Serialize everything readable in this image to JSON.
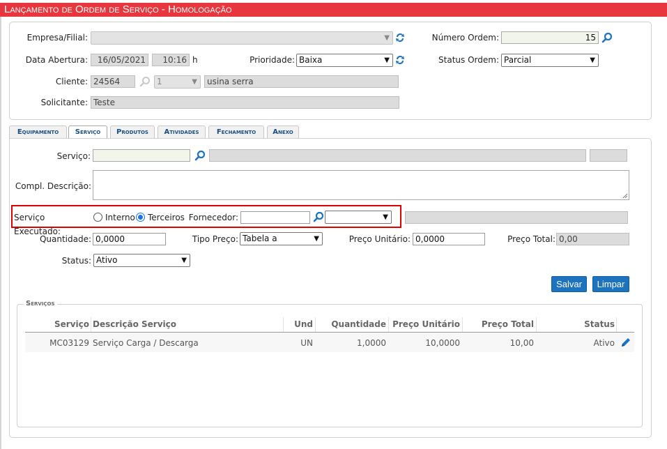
{
  "title": "Lançamento de Ordem de Serviço  - Homologação",
  "header": {
    "empresa_label": "Empresa/Filial:",
    "numero_ordem_label": "Número Ordem:",
    "numero_ordem_value": "15",
    "data_abertura_label": "Data Abertura:",
    "data_abertura_value": "16/05/2021",
    "hora_value": "10:16",
    "hora_suffix": "h",
    "prioridade_label": "Prioridade:",
    "prioridade_value": "Baixa",
    "status_ordem_label": "Status Ordem:",
    "status_ordem_value": "Parcial",
    "cliente_label": "Cliente:",
    "cliente_code": "24564",
    "cliente_unit": "1",
    "cliente_name": "usina serra",
    "solicitante_label": "Solicitante:",
    "solicitante_value": "Teste"
  },
  "tabs": [
    "Equipamento",
    "Serviço",
    "Produtos",
    "Atividades",
    "Fechamento",
    "Anexo"
  ],
  "active_tab": "Serviço",
  "form": {
    "servico_label": "Serviço:",
    "compl_label": "Compl. Descrição:",
    "executado_label": "Serviço Executado:",
    "interno_label": "Interno",
    "terceiros_label": "Terceiros",
    "selected_option": "Terceiros",
    "fornecedor_label": "Fornecedor:",
    "quantidade_label": "Quantidade:",
    "quantidade_value": "0,0000",
    "tipo_preco_label": "Tipo Preço:",
    "tipo_preco_value": "Tabela a",
    "preco_unitario_label": "Preço Unitário:",
    "preco_unitario_value": "0,0000",
    "preco_total_label": "Preço Total:",
    "preco_total_value": "0,00",
    "status_label": "Status:",
    "status_value": "Ativo",
    "salvar_label": "Salvar",
    "limpar_label": "Limpar"
  },
  "services": {
    "legend": "Serviços",
    "columns": [
      "Serviço",
      "Descrição Serviço",
      "Und",
      "Quantidade",
      "Preço Unitário",
      "Preço Total",
      "Status"
    ],
    "rows": [
      {
        "servico": "MC03129",
        "descricao": "Serviço Carga / Descarga",
        "und": "UN",
        "quantidade": "1,0000",
        "preco_unitario": "10,0000",
        "preco_total": "10,00",
        "status": "Ativo"
      }
    ]
  },
  "colors": {
    "title_bar": "#e8363f",
    "button": "#1e73be",
    "highlight_box": "#e00000",
    "tab_text": "#1b4d80"
  },
  "icons": [
    "refresh-icon",
    "search-icon",
    "edit-pencil-icon"
  ]
}
